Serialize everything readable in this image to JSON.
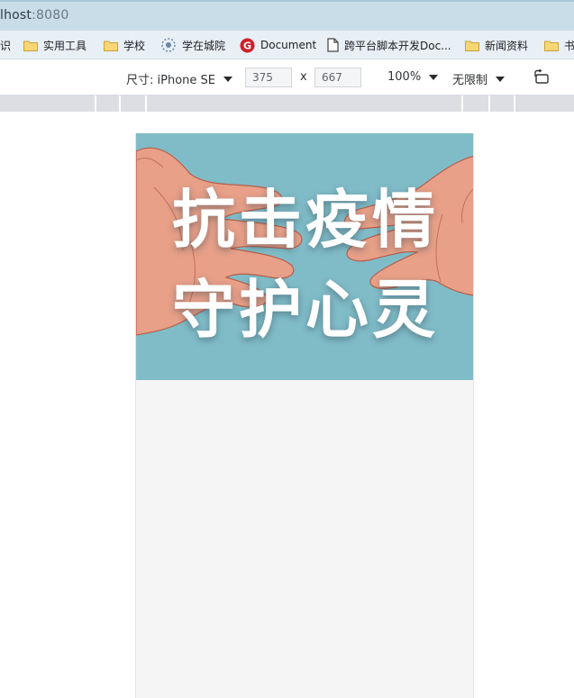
{
  "browser": {
    "url_host": "lhost",
    "url_port": ":8080",
    "bookmarks": [
      {
        "label": "识",
        "icon": "folder-icon"
      },
      {
        "label": "实用工具",
        "icon": "folder-icon"
      },
      {
        "label": "学校",
        "icon": "folder-icon"
      },
      {
        "label": "学在城院",
        "icon": "site-icon"
      },
      {
        "label": "Document",
        "icon": "red-g-icon"
      },
      {
        "label": "跨平台脚本开发Doc...",
        "icon": "file-icon"
      },
      {
        "label": "新闻资料",
        "icon": "folder-icon"
      },
      {
        "label": "书",
        "icon": "folder-icon"
      }
    ]
  },
  "devtools": {
    "size_label": "尺寸: iPhone SE",
    "width": "375",
    "times": "x",
    "height": "667",
    "zoom": "100%",
    "throttle": "无限制",
    "rotate_icon": "rotate-icon"
  },
  "page": {
    "banner": {
      "line1": "抗击疫情",
      "line2": "守护心灵",
      "bg_color": "#80bcc8"
    }
  }
}
